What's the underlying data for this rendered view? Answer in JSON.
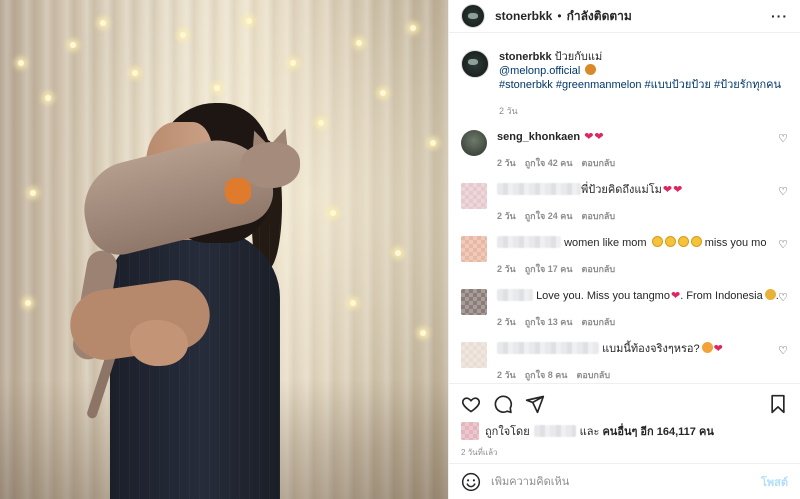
{
  "post": {
    "username": "stonerbkk",
    "follow_status": "กำลังติดตาม",
    "more_icon": "more-horizontal-icon"
  },
  "caption": {
    "username": "stonerbkk",
    "text": "ป้วยกับแม่",
    "mention": "@melonp.official",
    "hashtags": "#stonerbkk #greenmanmelon #แบบป้วยป้วย #ป้วยรักทุกคน",
    "time": "2 วัน"
  },
  "comments": [
    {
      "username": "seng_khonkaen",
      "text": "",
      "time": "2 วัน",
      "likes": "ถูกใจ 42 คน",
      "reply": "ตอบกลับ"
    },
    {
      "username": "",
      "text": "พี่ป้วยคิดถึงแม่โม",
      "time": "2 วัน",
      "likes": "ถูกใจ 24 คน",
      "reply": "ตอบกลับ"
    },
    {
      "username": "",
      "text": "women like mom",
      "text_after": "miss you mo",
      "time": "2 วัน",
      "likes": "ถูกใจ 17 คน",
      "reply": "ตอบกลับ"
    },
    {
      "username": "",
      "text": "Love you. Miss you tangmo",
      "text_after": ". From Indonesia",
      "time": "2 วัน",
      "likes": "ถูกใจ 13 คน",
      "reply": "ตอบกลับ"
    },
    {
      "username": "",
      "text": "แบมนี้ท้องจริงๆหรอ?",
      "time": "2 วัน",
      "likes": "ถูกใจ 8 คน",
      "reply": "ตอบกลับ"
    }
  ],
  "likes_summary": {
    "prefix": "ถูกใจโดย",
    "and": "และ",
    "others": "คนอื่นๆ อีก 164,117 คน"
  },
  "posted_time": "2 วันที่แล้ว",
  "add_comment": {
    "placeholder": "เพิ่มความคิดเห็น",
    "post_label": "โพสต์"
  },
  "colors": {
    "link": "#00376b",
    "meta": "#8e8e8e",
    "post_button": "#b2dffc",
    "heart": "#e0245e"
  }
}
